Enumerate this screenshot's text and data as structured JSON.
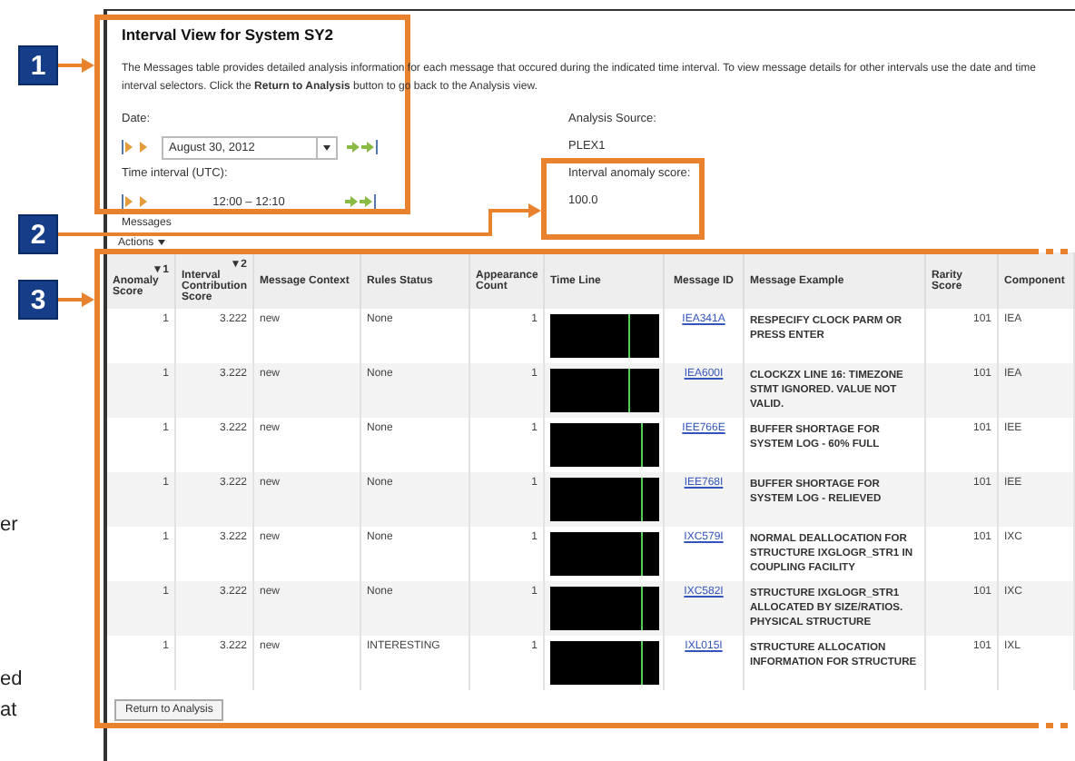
{
  "margin_text": [
    "er",
    "ed",
    "at"
  ],
  "callouts": [
    {
      "number": "1"
    },
    {
      "number": "2"
    },
    {
      "number": "3"
    }
  ],
  "title": "Interval View for System SY2",
  "description": "The Messages table provides detailed analysis information for each message that occured during the indicated time interval. To view message details for other intervals use the date and time interval selectors. Click the **Return to Analysis** button to go back to the Analysis view.",
  "date": {
    "label": "Date:",
    "value": "August 30, 2012"
  },
  "time_interval": {
    "label": "Time interval (UTC):",
    "value": "12:00 – 12:10"
  },
  "analysis_source": {
    "label": "Analysis Source:",
    "value": "PLEX1"
  },
  "interval_score": {
    "label": "Interval anomaly score:",
    "value": "100.0"
  },
  "messages": {
    "label": "Messages",
    "actions": "Actions"
  },
  "table": {
    "columns": [
      {
        "label": "Anomaly Score",
        "sort": "▼1"
      },
      {
        "label": "Interval Contribution Score",
        "sort": "▼2"
      },
      {
        "label": "Message Context"
      },
      {
        "label": "Rules Status"
      },
      {
        "label": "Appearance Count"
      },
      {
        "label": "Time Line"
      },
      {
        "label": "Message ID"
      },
      {
        "label": "Message Example"
      },
      {
        "label": "Rarity Score"
      },
      {
        "label": "Component"
      }
    ],
    "rows": [
      {
        "anomaly": "1",
        "contribution": "3.222",
        "context": "new",
        "rules": "None",
        "count": "1",
        "level": 0.72,
        "id": "IEA341A",
        "example": "RESPECIFY CLOCK PARM OR PRESS ENTER",
        "rarity": "101",
        "component": "IEA"
      },
      {
        "anomaly": "1",
        "contribution": "3.222",
        "context": "new",
        "rules": "None",
        "count": "1",
        "level": 0.72,
        "id": "IEA600I",
        "example": "CLOCKZX LINE 16: TIMEZONE STMT IGNORED. VALUE NOT VALID.",
        "rarity": "101",
        "component": "IEA"
      },
      {
        "anomaly": "1",
        "contribution": "3.222",
        "context": "new",
        "rules": "None",
        "count": "1",
        "level": 0.83,
        "id": "IEE766E",
        "example": "BUFFER SHORTAGE FOR SYSTEM LOG - 60% FULL",
        "rarity": "101",
        "component": "IEE"
      },
      {
        "anomaly": "1",
        "contribution": "3.222",
        "context": "new",
        "rules": "None",
        "count": "1",
        "level": 0.83,
        "id": "IEE768I",
        "example": "BUFFER SHORTAGE FOR SYSTEM LOG - RELIEVED",
        "rarity": "101",
        "component": "IEE"
      },
      {
        "anomaly": "1",
        "contribution": "3.222",
        "context": "new",
        "rules": "None",
        "count": "1",
        "level": 0.83,
        "id": "IXC579I",
        "example": "NORMAL DEALLOCATION FOR STRUCTURE IXGLOGR_STR1 IN COUPLING FACILITY",
        "rarity": "101",
        "component": "IXC"
      },
      {
        "anomaly": "1",
        "contribution": "3.222",
        "context": "new",
        "rules": "None",
        "count": "1",
        "level": 0.83,
        "id": "IXC582I",
        "example": "STRUCTURE IXGLOGR_STR1 ALLOCATED BY SIZE/RATIOS. PHYSICAL STRUCTURE",
        "rarity": "101",
        "component": "IXC"
      },
      {
        "anomaly": "1",
        "contribution": "3.222",
        "context": "new",
        "rules": "INTERESTING",
        "count": "1",
        "level": 0.83,
        "id": "IXL015I",
        "example": "STRUCTURE ALLOCATION INFORMATION FOR STRUCTURE",
        "rarity": "101",
        "component": "IXL"
      }
    ]
  },
  "return_button": "Return to Analysis"
}
